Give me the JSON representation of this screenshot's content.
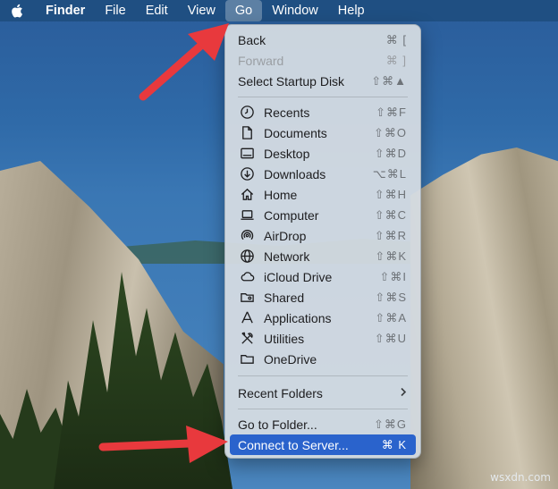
{
  "menubar": {
    "app_name": "Finder",
    "items": [
      "File",
      "Edit",
      "View",
      "Go",
      "Window",
      "Help"
    ],
    "active_item": "Go",
    "bar_color": "#1f4f82"
  },
  "go_menu": {
    "group1": [
      {
        "label": "Back",
        "shortcut": "⌘ [",
        "enabled": true
      },
      {
        "label": "Forward",
        "shortcut": "⌘ ]",
        "enabled": false
      },
      {
        "label": "Select Startup Disk",
        "shortcut": "⇧⌘▲",
        "enabled": true
      }
    ],
    "places": [
      {
        "label": "Recents",
        "shortcut": "⇧⌘F",
        "icon": "clock-icon"
      },
      {
        "label": "Documents",
        "shortcut": "⇧⌘O",
        "icon": "document-icon"
      },
      {
        "label": "Desktop",
        "shortcut": "⇧⌘D",
        "icon": "desktop-icon"
      },
      {
        "label": "Downloads",
        "shortcut": "⌥⌘L",
        "icon": "download-icon"
      },
      {
        "label": "Home",
        "shortcut": "⇧⌘H",
        "icon": "home-icon"
      },
      {
        "label": "Computer",
        "shortcut": "⇧⌘C",
        "icon": "laptop-icon"
      },
      {
        "label": "AirDrop",
        "shortcut": "⇧⌘R",
        "icon": "airdrop-icon"
      },
      {
        "label": "Network",
        "shortcut": "⇧⌘K",
        "icon": "network-globe-icon"
      },
      {
        "label": "iCloud Drive",
        "shortcut": "⇧⌘I",
        "icon": "cloud-icon"
      },
      {
        "label": "Shared",
        "shortcut": "⇧⌘S",
        "icon": "shared-folder-icon"
      },
      {
        "label": "Applications",
        "shortcut": "⇧⌘A",
        "icon": "applications-icon"
      },
      {
        "label": "Utilities",
        "shortcut": "⇧⌘U",
        "icon": "utilities-tools-icon"
      },
      {
        "label": "OneDrive",
        "shortcut": "",
        "icon": "folder-icon"
      }
    ],
    "recent_folders": {
      "label": "Recent Folders",
      "chevron": ">"
    },
    "group_last": [
      {
        "label": "Go to Folder...",
        "shortcut": "⇧⌘G",
        "selected": false
      },
      {
        "label": "Connect to Server...",
        "shortcut": "⌘ K",
        "selected": true
      }
    ],
    "highlight_color": "#2a63cc"
  },
  "watermark": "wsxdn.com",
  "annotation_color": "#e8393d"
}
